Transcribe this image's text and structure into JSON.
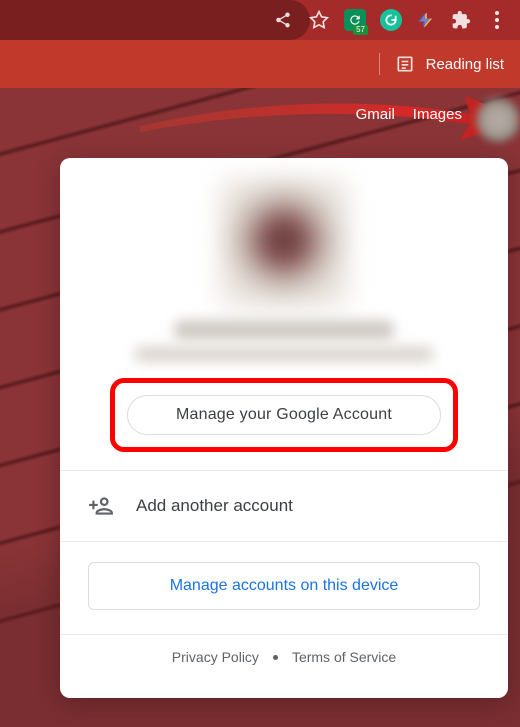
{
  "browser": {
    "ext_count": "57",
    "reading_list": "Reading list"
  },
  "top": {
    "gmail": "Gmail",
    "images": "Images"
  },
  "card": {
    "manage_label": "Manage your Google Account",
    "add_label": "Add another account",
    "device_label": "Manage accounts on this device",
    "privacy_label": "Privacy Policy",
    "terms_label": "Terms of Service"
  }
}
